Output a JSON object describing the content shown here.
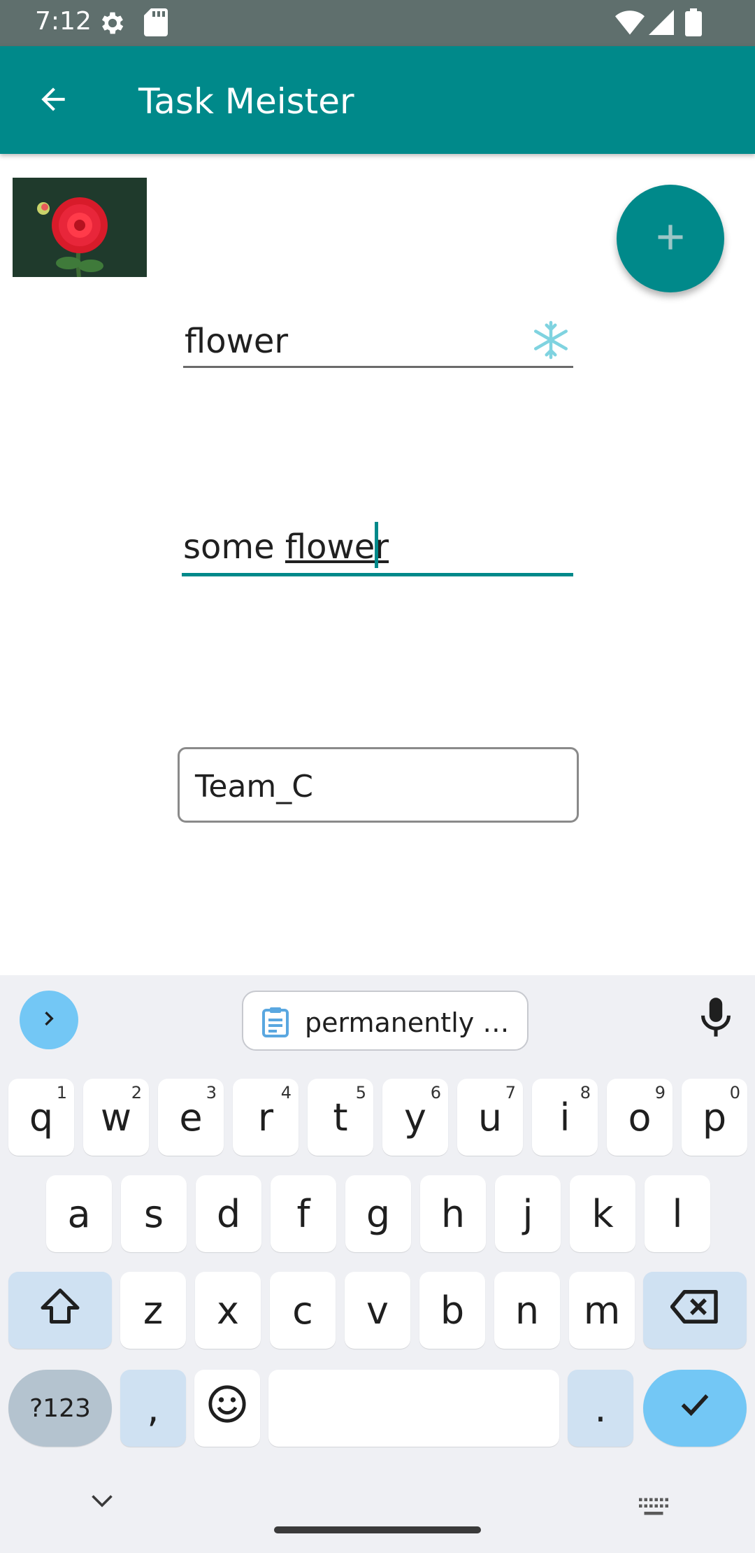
{
  "status_bar": {
    "time": "7:12"
  },
  "app_bar": {
    "title": "Task Meister"
  },
  "form": {
    "name_value": "flower",
    "description_prefix": "some ",
    "description_underlined": "flower",
    "team_value": "Team_C"
  },
  "keyboard": {
    "clipboard_chip": "permanently …",
    "row1": [
      {
        "label": "q",
        "sup": "1"
      },
      {
        "label": "w",
        "sup": "2"
      },
      {
        "label": "e",
        "sup": "3"
      },
      {
        "label": "r",
        "sup": "4"
      },
      {
        "label": "t",
        "sup": "5"
      },
      {
        "label": "y",
        "sup": "6"
      },
      {
        "label": "u",
        "sup": "7"
      },
      {
        "label": "i",
        "sup": "8"
      },
      {
        "label": "o",
        "sup": "9"
      },
      {
        "label": "p",
        "sup": "0"
      }
    ],
    "row2": [
      "a",
      "s",
      "d",
      "f",
      "g",
      "h",
      "j",
      "k",
      "l"
    ],
    "row3": [
      "z",
      "x",
      "c",
      "v",
      "b",
      "n",
      "m"
    ],
    "symbols_label": "?123",
    "comma_label": ",",
    "period_label": "."
  },
  "colors": {
    "primary": "#00898a",
    "accent": "#73c7f5",
    "status_bar": "#5f6f6d"
  }
}
